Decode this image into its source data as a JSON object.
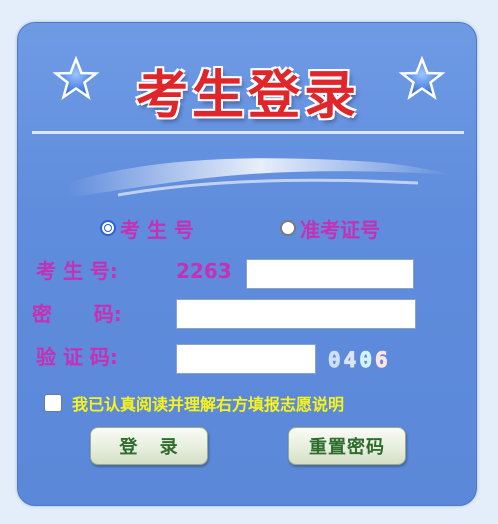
{
  "title": "考生登录",
  "login_type": {
    "options": [
      {
        "label": "考 生 号",
        "selected": true
      },
      {
        "label": "准考证号",
        "selected": false
      }
    ]
  },
  "form": {
    "candidate_label": "考 生 号:",
    "candidate_prefix": "2263",
    "candidate_value": "",
    "password_label": "密      码:",
    "password_value": "",
    "captcha_label": "验 证 码:",
    "captcha_value": "",
    "captcha_digits": [
      "0",
      "4",
      "0",
      "6"
    ]
  },
  "agreement": {
    "checked": false,
    "text": "我已认真阅读并理解右方填报志愿说明"
  },
  "buttons": {
    "login": "登 录",
    "reset": "重置密码"
  },
  "colors": {
    "panel": "#5f8cdc",
    "label": "#c630b4",
    "title": "#e0262a",
    "agreement_text": "#f7f31d",
    "button_text": "#2e6d2e"
  },
  "icons": {
    "title_star": "star-icon"
  }
}
